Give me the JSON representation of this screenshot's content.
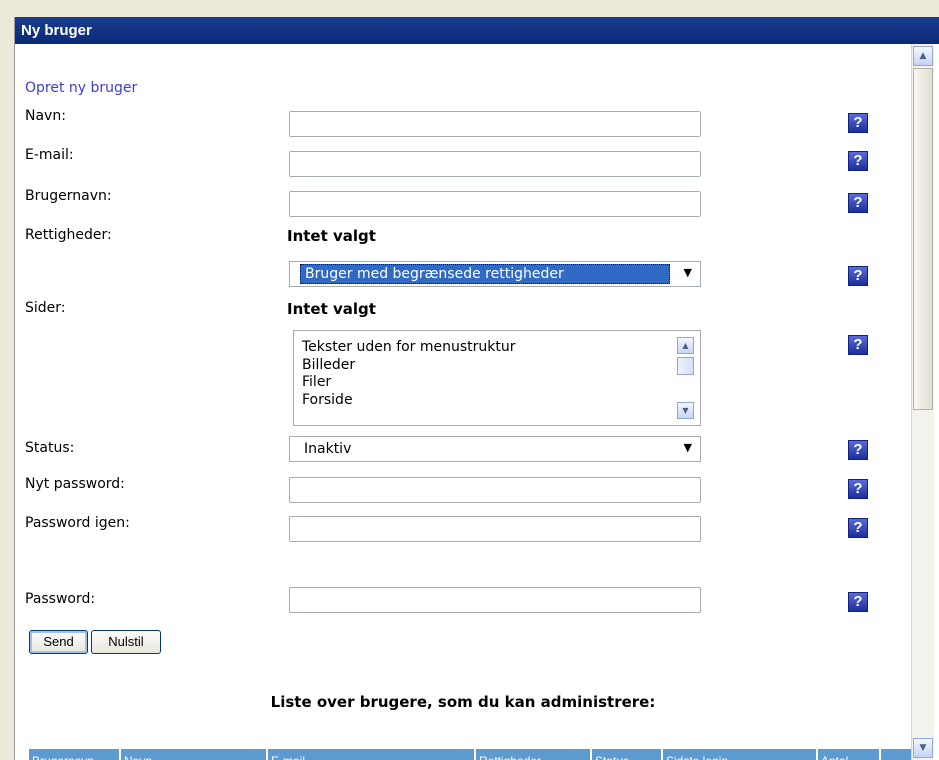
{
  "window": {
    "title": "Ny bruger"
  },
  "form": {
    "subtitle": "Opret ny bruger",
    "fields": {
      "navn": {
        "label": "Navn:",
        "value": ""
      },
      "email": {
        "label": "E-mail:",
        "value": ""
      },
      "brugernavn": {
        "label": "Brugernavn:",
        "value": ""
      },
      "nyt_password": {
        "label": "Nyt password:",
        "value": ""
      },
      "password_igen": {
        "label": "Password igen:",
        "value": ""
      },
      "password": {
        "label": "Password:",
        "value": ""
      }
    },
    "rettigheder": {
      "label": "Rettigheder:",
      "status": "Intet valgt",
      "selected": "Bruger med begrænsede rettigheder"
    },
    "sider": {
      "label": "Sider:",
      "status": "Intet valgt",
      "options": [
        "Tekster uden for menustruktur",
        "Billeder",
        "Filer",
        "Forside"
      ]
    },
    "status": {
      "label": "Status:",
      "selected": "Inaktiv"
    },
    "help_glyph": "?",
    "buttons": {
      "send": "Send",
      "reset": "Nulstil"
    }
  },
  "users_list": {
    "heading": "Liste over brugere, som du kan administrere:",
    "columns": [
      "Brugernavn",
      "Navn",
      "E-mail",
      "Rettigheder",
      "Status",
      "Sidste login",
      "Antal"
    ]
  },
  "icons": {
    "help": "question-help-icon",
    "dropdown": "dropdown-arrow-icon",
    "scroll_up": "scroll-up-icon",
    "scroll_down": "scroll-down-icon"
  },
  "colors": {
    "titlebar": "#0a2a78",
    "subtitle": "#3b3bd6",
    "table_header": "#5d9ad0",
    "selection": "#316ac5"
  }
}
